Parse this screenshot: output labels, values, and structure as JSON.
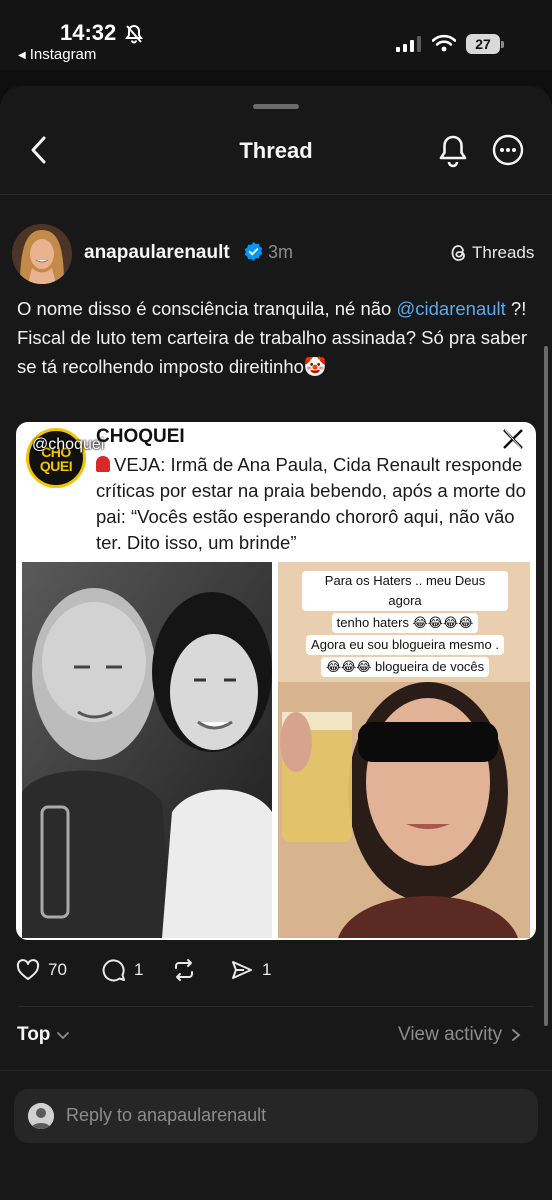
{
  "status_bar": {
    "time": "14:32",
    "back_app": "Instagram",
    "battery": "27"
  },
  "header": {
    "title": "Thread"
  },
  "post": {
    "username": "anapaularenault",
    "time_ago": "3m",
    "threads_link": "Threads",
    "text_before": "O nome disso é consciência tranquila, né não ",
    "mention": "@cidarenault",
    "text_after": " ?! Fiscal de luto tem carteira de trabalho assinada? Só pra saber se tá recolhendo imposto direitinho🤡",
    "media": {
      "source_name": "CHOQUEI",
      "logo_text": "CHO QUEI",
      "handle": "@choquei",
      "headline": "VEJA: Irmã de Ana Paula, Cida Renault responde críticas por estar na praia bebendo, após a morte do pai: “Vocês estão esperando chororô aqui, não vão ter. Dito isso, um brinde”",
      "story_caption": [
        "Para os Haters .. meu Deus agora",
        "tenho haters 😂😂😂😂",
        "Agora eu sou blogueira mesmo .",
        "😂😂😂 blogueira de vocês"
      ]
    },
    "likes": "70",
    "comments": "1",
    "shares": "1"
  },
  "activity": {
    "sort_label": "Top",
    "view_activity": "View activity"
  },
  "reply": {
    "placeholder": "Reply to anapaularenault"
  },
  "colors": {
    "background": "#181818",
    "mention": "#5aa9f2",
    "verified": "#0095f6"
  }
}
